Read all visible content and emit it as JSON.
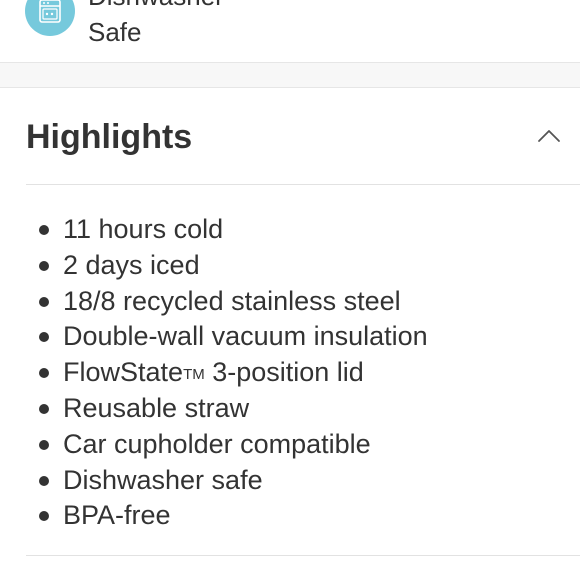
{
  "feature": {
    "icon": "dishwasher-icon",
    "icon_color": "#76c9dc",
    "label_line1": "Dishwasher",
    "label_line2": "Safe"
  },
  "highlights": {
    "title": "Highlights",
    "toggle_icon": "chevron-up-icon",
    "items": [
      {
        "text": "11 hours cold"
      },
      {
        "text": "2 days iced"
      },
      {
        "text": "18/8 recycled stainless steel"
      },
      {
        "text": "Double-wall vacuum insulation"
      },
      {
        "text": "FlowState",
        "tm": "TM",
        "suffix": " 3-position lid"
      },
      {
        "text": "Reusable straw"
      },
      {
        "text": "Car cupholder compatible"
      },
      {
        "text": "Dishwasher safe"
      },
      {
        "text": "BPA-free"
      }
    ]
  }
}
